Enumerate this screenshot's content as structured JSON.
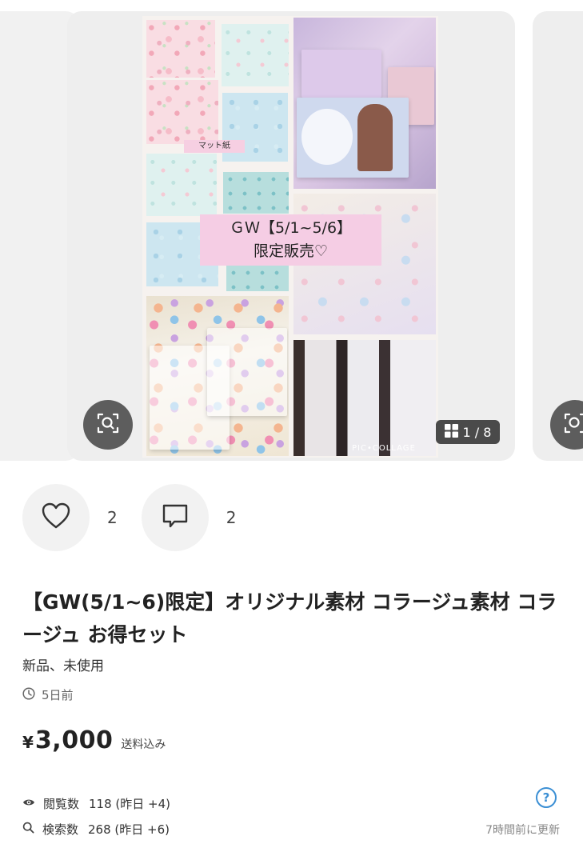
{
  "carousel": {
    "mat_label": "マット紙",
    "promo_line1": "ＧＷ【5/1~5/6】",
    "promo_line2": "限定販売♡",
    "watermark": "PIC•COLLAGE",
    "counter": "1 / 8",
    "icons": {
      "zoom": "image-search-icon",
      "grid": "grid-icon"
    }
  },
  "actions": {
    "like_count": "2",
    "comment_count": "2",
    "icons": {
      "like": "heart-icon",
      "comment": "comment-icon"
    }
  },
  "item": {
    "title": "【GW(5/1~6)限定】オリジナル素材 コラージュ素材 コラージュ お得セット",
    "condition": "新品、未使用",
    "posted": "5日前",
    "currency": "¥",
    "price": "3,000",
    "shipping_note": "送料込み"
  },
  "stats": {
    "views_label": "閲覧数",
    "views_value": "118 (昨日 +4)",
    "searches_label": "検索数",
    "searches_value": "268 (昨日 +6)",
    "help": "?",
    "updated": "7時間前に更新"
  }
}
